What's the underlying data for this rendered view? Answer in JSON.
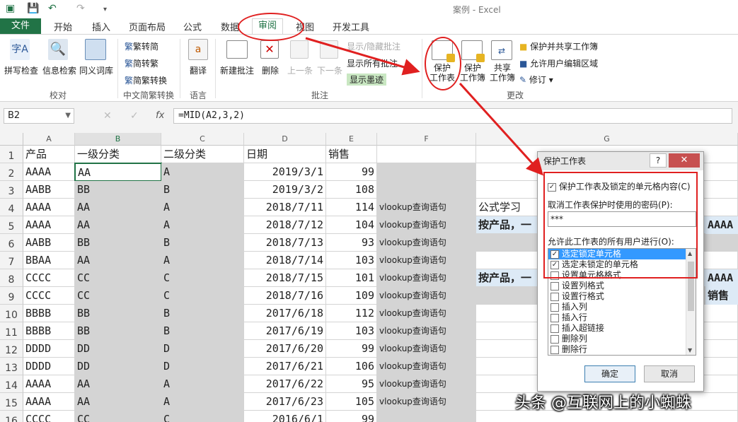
{
  "window": {
    "title": "案例 - Excel"
  },
  "tabs": [
    "文件",
    "开始",
    "插入",
    "页面布局",
    "公式",
    "数据",
    "审阅",
    "视图",
    "开发工具"
  ],
  "ribbon": {
    "proofing": {
      "spell": "拼写检查",
      "research": "信息检索",
      "thesaurus": "同义词库",
      "group": "校对"
    },
    "chinese": {
      "to_simp": "繁转简",
      "to_trad": "简转繁",
      "convert": "简繁转换",
      "group": "中文简繁转换"
    },
    "language": {
      "translate": "翻译",
      "group": "语言"
    },
    "comments": {
      "new": "新建批注",
      "delete": "删除",
      "prev": "上一条",
      "next": "下一条",
      "show_hide": "显示/隐藏批注",
      "show_all": "显示所有批注",
      "show_ink": "显示墨迹",
      "group": "批注"
    },
    "changes": {
      "protect_sheet": "保护\n工作表",
      "protect_book": "保护\n工作簿",
      "share_book": "共享\n工作簿",
      "protect_share": "保护并共享工作簿",
      "allow_edit": "允许用户编辑区域",
      "track": "修订",
      "group": "更改"
    }
  },
  "formula_bar": {
    "name_box": "B2",
    "fx": "fx",
    "formula": "=MID(A2,3,2)"
  },
  "columns": [
    "A",
    "B",
    "C",
    "D",
    "E",
    "F",
    "G"
  ],
  "headers": [
    "产品",
    "一级分类",
    "二级分类",
    "日期",
    "销售"
  ],
  "rows": [
    [
      "AAAA",
      "AA",
      "A",
      "2019/3/1",
      "99",
      ""
    ],
    [
      "AABB",
      "BB",
      "B",
      "2019/3/2",
      "108",
      ""
    ],
    [
      "AAAA",
      "AA",
      "A",
      "2018/7/11",
      "114",
      "vlookup查询语句"
    ],
    [
      "AAAA",
      "AA",
      "A",
      "2018/7/12",
      "104",
      "vlookup查询语句"
    ],
    [
      "AABB",
      "BB",
      "B",
      "2018/7/13",
      "93",
      "vlookup查询语句"
    ],
    [
      "BBAA",
      "AA",
      "A",
      "2018/7/14",
      "103",
      "vlookup查询语句"
    ],
    [
      "CCCC",
      "CC",
      "C",
      "2018/7/15",
      "101",
      "vlookup查询语句"
    ],
    [
      "CCCC",
      "CC",
      "C",
      "2018/7/16",
      "109",
      "vlookup查询语句"
    ],
    [
      "BBBB",
      "BB",
      "B",
      "2017/6/18",
      "112",
      "vlookup查询语句"
    ],
    [
      "BBBB",
      "BB",
      "B",
      "2017/6/19",
      "103",
      "vlookup查询语句"
    ],
    [
      "DDDD",
      "DD",
      "D",
      "2017/6/20",
      "99",
      "vlookup查询语句"
    ],
    [
      "DDDD",
      "DD",
      "D",
      "2017/6/21",
      "106",
      "vlookup查询语句"
    ],
    [
      "AAAA",
      "AA",
      "A",
      "2017/6/22",
      "95",
      "vlookup查询语句"
    ],
    [
      "AAAA",
      "AA",
      "A",
      "2017/6/23",
      "105",
      "vlookup查询语句"
    ],
    [
      "CCCC",
      "CC",
      "C",
      "2016/6/1",
      "99",
      ""
    ]
  ],
  "g_column": {
    "r3": "公式学习",
    "r4": "按产品，一",
    "r4_tail": "AAAA A",
    "r7": "按产品，一",
    "r7_tail": "AAAA A",
    "r8_tail": "销售"
  },
  "dialog": {
    "title": "保护工作表",
    "help": "?",
    "close": "✕",
    "protect_label": "保护工作表及锁定的单元格内容(C)",
    "password_label": "取消工作表保护时使用的密码(P):",
    "password_value": "***",
    "allow_label": "允许此工作表的所有用户进行(O):",
    "options": [
      {
        "label": "选定锁定单元格",
        "checked": true
      },
      {
        "label": "选定未锁定的单元格",
        "checked": true
      },
      {
        "label": "设置单元格格式",
        "checked": false
      },
      {
        "label": "设置列格式",
        "checked": false
      },
      {
        "label": "设置行格式",
        "checked": false
      },
      {
        "label": "插入列",
        "checked": false
      },
      {
        "label": "插入行",
        "checked": false
      },
      {
        "label": "插入超链接",
        "checked": false
      },
      {
        "label": "删除列",
        "checked": false
      },
      {
        "label": "删除行",
        "checked": false
      }
    ],
    "ok": "确定",
    "cancel": "取消"
  },
  "watermark": "头条 @互联网上的小蜘蛛",
  "colors": {
    "accent": "#217346",
    "annotation": "#e02020",
    "selection": "#3399ff"
  }
}
